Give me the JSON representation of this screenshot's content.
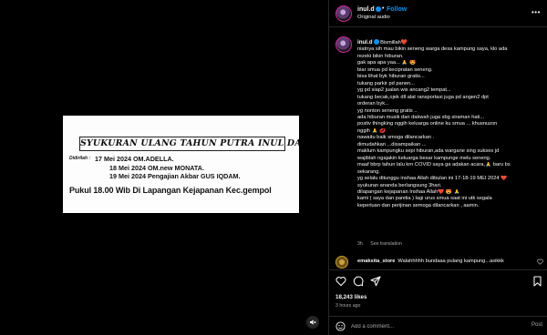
{
  "media": {
    "poster": {
      "title": "SYUKURAN ULANG TAHUN PUTRA INUL DARATISTA",
      "label_prefix": "Didirilah :",
      "events": [
        "17 Mei 2024 OM.ADELLA.",
        "18 Mei 2024 OM.new MONATA.",
        "19 Mei 2024 Pengajian Akbar GUS IQDAM."
      ],
      "footer": "Pukul 18.00 Wib Di Lapangan Kejapanan Kec.gempol"
    },
    "audio_icon": "speaker-icon"
  },
  "header": {
    "username": "inul.d",
    "follow_label": "Follow",
    "audio_label": "Original audio",
    "separator": "•",
    "more_label": "•••"
  },
  "caption": {
    "username": "inul.d",
    "lines": [
      "niatnya sih mau bikin seneng warga desa kampung saya, klo ada",
      "rezeki bikin hiburan.",
      "gak apa apa yaa... 🙏 😍",
      "biar smua pd kecipratan seneng.",
      "bisa lihat byk hiburan gratis...",
      "tukang parkir pd panen...",
      "yg pd siap2 jualan wis ancang2 tempat...",
      "tukang becak,ojek dll alat ransportasi juga pd angen2 dpt",
      "orderan byk...",
      "yg nonton seneng gratis ..",
      "ada hiburan musik dan dakwah juga sbg siraman hati...",
      "postiv thingking nggih keluarga online ku smua ... khusnuzon",
      "nggih 🙏 💋",
      "nawaitu baik smoga dilancarkan .",
      "dimudahkan ...disampaikan ...",
      "maklum kampungku sepi hiburan,ada wargane sing sukses jd",
      "wajiblah ngajakin keluarga besar kampunge melu seneng.",
      "maaf bbrp tahun lalu krn COVID saya ga adakan acara,🙏 baru bs",
      "sekarang.",
      "yg selalu ditunggu inshaa Allah dibulan ini 17-18-19 MEI 2024 ❤️",
      "syukuran ananda berlangsung 3hari.",
      "dilapangan kejapanan Inshaa Allah❤️ 😍 🙏",
      "kami ( saya dan panitia ) lagi urus smua saat ini utk segala",
      "keperluan dan perijinan semoga dilancarkan , aamin."
    ],
    "first_line_suffix": "Bismillah❤️",
    "time": "3h",
    "see_translation": "See translation"
  },
  "comment": {
    "username": "emaksita_store",
    "text": "Walahhhhh bundaaa pulang kampung...asikkk"
  },
  "actions": {
    "likes": "18,243 likes",
    "time_ago": "3 hours ago"
  },
  "add_comment": {
    "placeholder": "Add a comment...",
    "post_label": "Post"
  },
  "colors": {
    "background": "#000000",
    "link": "#0095f6",
    "muted": "#a8a8a8",
    "divider": "#262626"
  }
}
